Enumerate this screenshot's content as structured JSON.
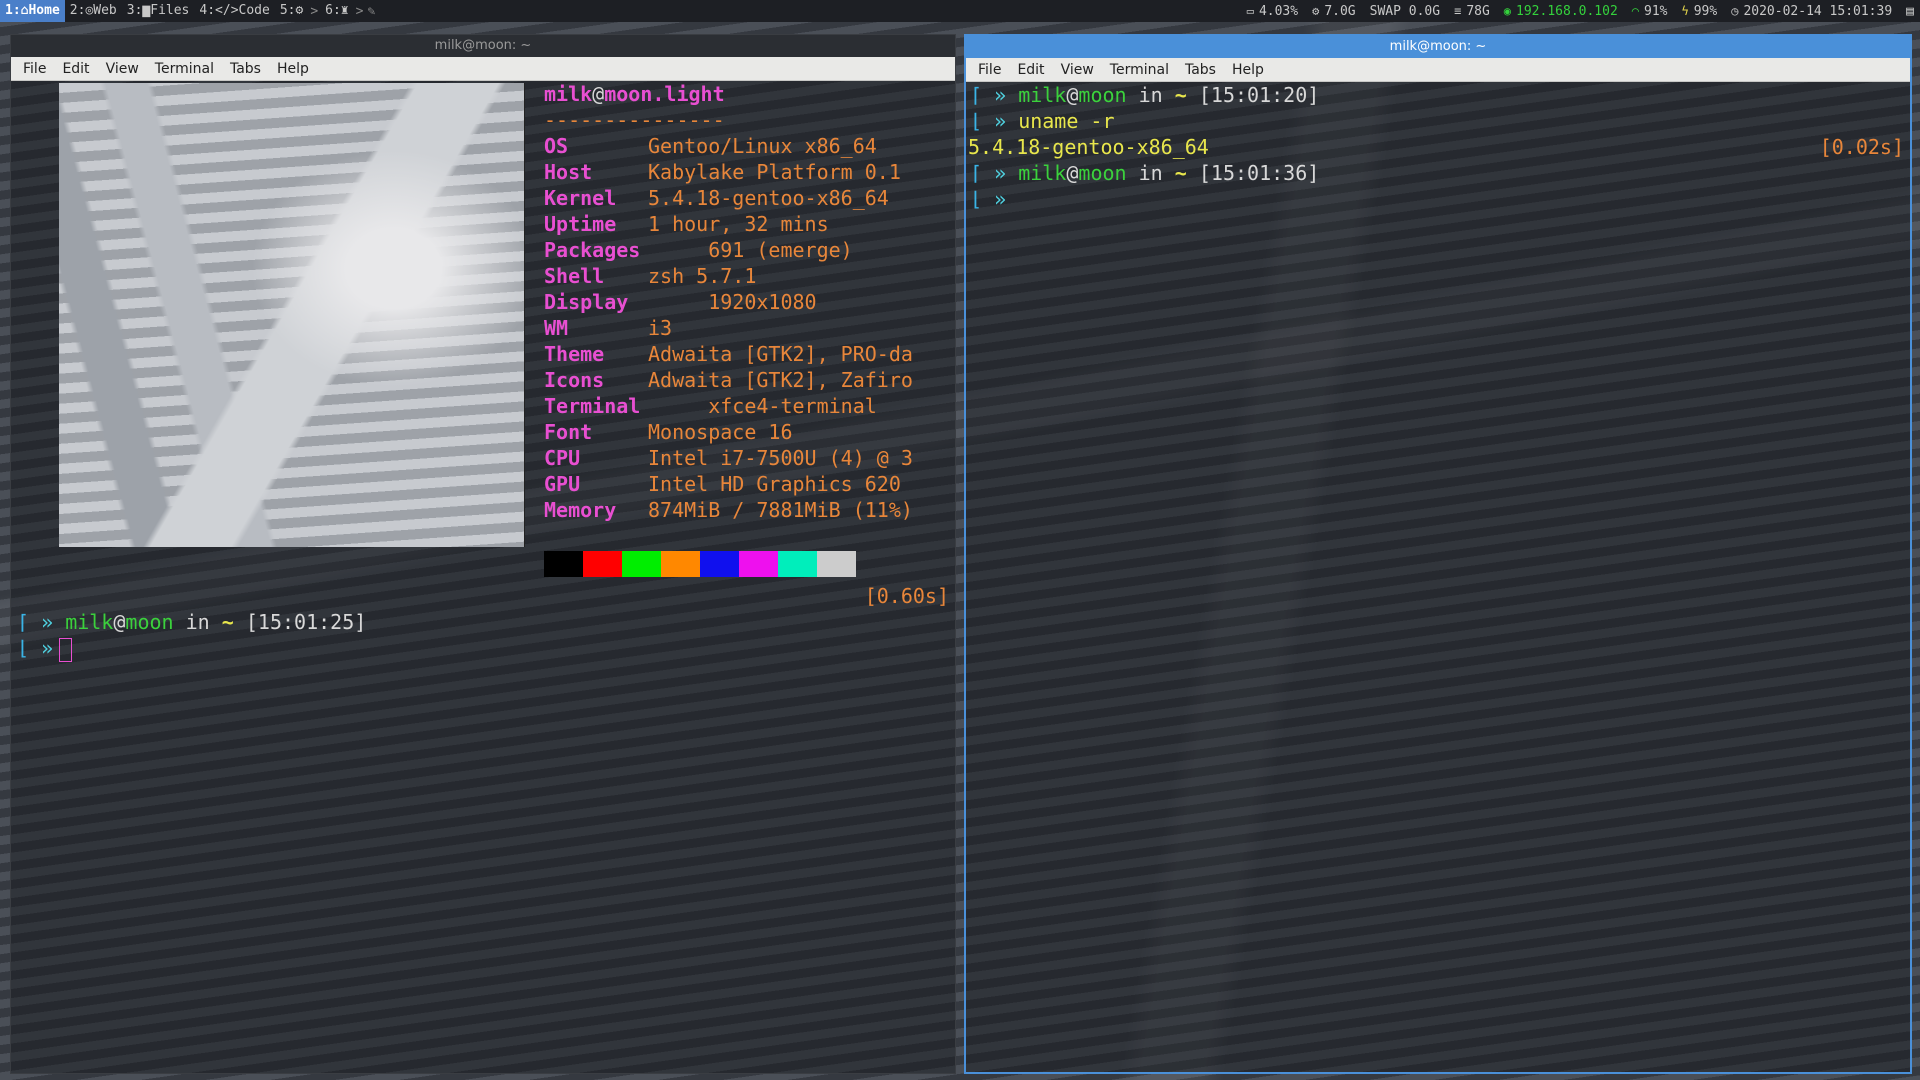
{
  "bar": {
    "workspaces": [
      {
        "label": "1:⌂Home",
        "active": true
      },
      {
        "label": "2:◎Web",
        "active": false
      },
      {
        "label": "3:▆Files",
        "active": false
      },
      {
        "label": "4:</>Code",
        "active": false
      },
      {
        "label": "5:⚙",
        "active": false
      },
      {
        "label": "6:♜",
        "active": false
      }
    ],
    "cpu": "4.03%",
    "ram": "7.0G",
    "swap": "SWAP 0.0G",
    "disk": "78G",
    "ip": "192.168.0.102",
    "wifi": "91%",
    "battery": "99%",
    "datetime": "2020-02-14 15:01:39"
  },
  "left_window": {
    "title": "milk@moon: ~",
    "menu": [
      "File",
      "Edit",
      "View",
      "Terminal",
      "Tabs",
      "Help"
    ],
    "neofetch": {
      "user": "milk",
      "host": "moon.light",
      "separator": "---------------",
      "rows": [
        {
          "key": "OS",
          "value": "Gentoo/Linux x86_64"
        },
        {
          "key": "Host",
          "value": "Kabylake Platform 0.1"
        },
        {
          "key": "Kernel",
          "value": "5.4.18-gentoo-x86_64"
        },
        {
          "key": "Uptime",
          "value": "1 hour, 32 mins"
        },
        {
          "key": "Packages",
          "value": "     691 (emerge)"
        },
        {
          "key": "Shell",
          "value": "zsh 5.7.1"
        },
        {
          "key": "Display",
          "value": "     1920x1080"
        },
        {
          "key": "WM",
          "value": "i3"
        },
        {
          "key": "Theme",
          "value": "Adwaita [GTK2], PRO-da"
        },
        {
          "key": "Icons",
          "value": "Adwaita [GTK2], Zafiro"
        },
        {
          "key": "Terminal",
          "value": "     xfce4-terminal"
        },
        {
          "key": "Font",
          "value": "Monospace 16"
        },
        {
          "key": "CPU",
          "value": "Intel i7-7500U (4) @ 3"
        },
        {
          "key": "GPU",
          "value": "Intel HD Graphics 620"
        },
        {
          "key": "Memory",
          "value": "874MiB / 7881MiB (11%)"
        }
      ],
      "palette": [
        "#000000",
        "#ff0000",
        "#00ee00",
        "#ff8800",
        "#1010ee",
        "#ee10ee",
        "#00eebb",
        "#cccccc"
      ]
    },
    "timing": "[0.60s]",
    "prompt": {
      "user": "milk",
      "host": "moon",
      "in": "in",
      "dir": "~",
      "time": "[15:01:25]"
    }
  },
  "right_window": {
    "title": "milk@moon: ~",
    "menu": [
      "File",
      "Edit",
      "View",
      "Terminal",
      "Tabs",
      "Help"
    ],
    "prompt1": {
      "user": "milk",
      "host": "moon",
      "in": "in",
      "dir": "~",
      "time": "[15:01:20]"
    },
    "command": "uname -r",
    "output": "5.4.18-gentoo-x86_64",
    "timing": "[0.02s]",
    "prompt2": {
      "user": "milk",
      "host": "moon",
      "in": "in",
      "dir": "~",
      "time": "[15:01:36]"
    }
  }
}
